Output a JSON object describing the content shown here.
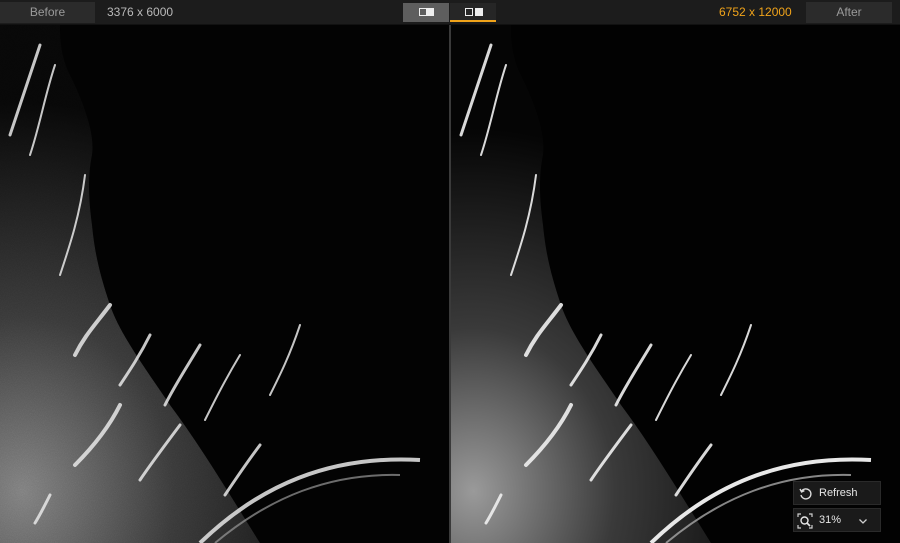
{
  "toolbar": {
    "before_label": "Before",
    "after_label": "After",
    "before_resolution": "3376 x 6000",
    "after_resolution": "6752 x 12000",
    "view_modes": [
      "split-view",
      "side-by-side-view"
    ],
    "selected_view_mode": "side-by-side-view",
    "accent_color": "#f0a31a"
  },
  "controls": {
    "refresh_label": "Refresh",
    "zoom_level": "31%"
  },
  "icons": [
    "refresh-icon",
    "zoom-icon",
    "chevron-down-icon"
  ]
}
